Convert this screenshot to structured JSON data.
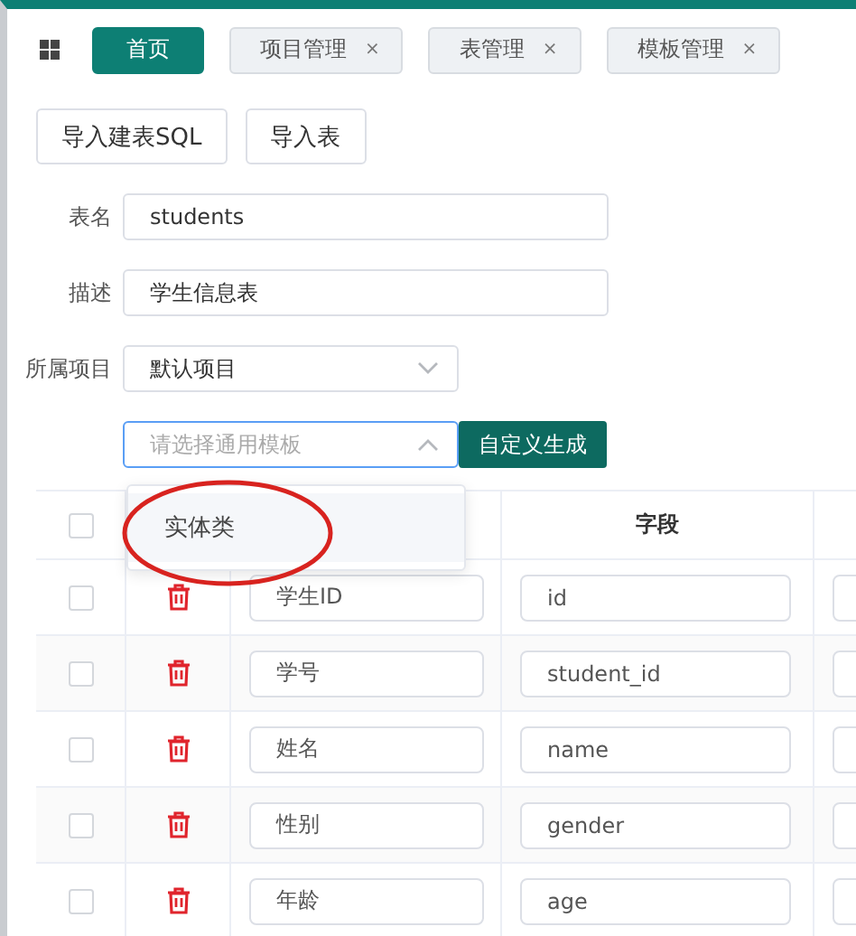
{
  "tabs": [
    {
      "label": "首页",
      "selected": true
    },
    {
      "label": "项目管理",
      "selected": false,
      "close": "×"
    },
    {
      "label": "表管理",
      "selected": false,
      "close": "×"
    },
    {
      "label": "模板管理",
      "selected": false,
      "close": "×"
    }
  ],
  "toolbar": {
    "buttons": [
      "导入建表SQL",
      "导入表"
    ]
  },
  "form": {
    "fields": [
      {
        "label": "表名",
        "kind": "input",
        "value": "students"
      },
      {
        "label": "描述",
        "kind": "input",
        "value": "学生信息表"
      },
      {
        "label": "所属项目",
        "kind": "select",
        "value": "默认项目"
      }
    ]
  },
  "template": {
    "placeholder": "请选择通用模板",
    "expanded": true,
    "button": "自定义生成",
    "options": [
      {
        "label": "实体类",
        "annotated": true
      }
    ]
  },
  "table": {
    "header_checked": false,
    "field_heading": "字段",
    "rows": [
      {
        "checked": false,
        "name": "学生ID",
        "field": "id"
      },
      {
        "checked": false,
        "name": "学号",
        "field": "student_id"
      },
      {
        "checked": false,
        "name": "姓名",
        "field": "name"
      },
      {
        "checked": false,
        "name": "性别",
        "field": "gender"
      },
      {
        "checked": false,
        "name": "年龄",
        "field": "age"
      }
    ]
  }
}
